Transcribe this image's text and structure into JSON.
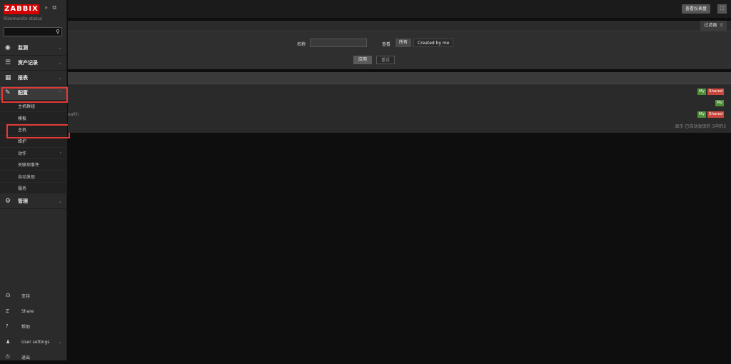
{
  "sidebar": {
    "logo": "ZABBIX",
    "server_name": "Rizemonito status",
    "search_placeholder": "",
    "collapse_icons": [
      "»",
      "⧉"
    ],
    "menu": [
      {
        "id": "monitoring",
        "label": "监测",
        "icon": "◉"
      },
      {
        "id": "inventory",
        "label": "资产记录",
        "icon": "☰"
      },
      {
        "id": "reports",
        "label": "报表",
        "icon": "▦"
      },
      {
        "id": "configuration",
        "label": "配置",
        "icon": "✎"
      }
    ],
    "config_submenu": [
      "主机群组",
      "模板",
      "主机",
      "维护",
      "动作",
      "关联项事件",
      "自动发现",
      "服务"
    ],
    "admin": {
      "label": "管理",
      "icon": "⚙"
    },
    "bottom": [
      {
        "label": "支持",
        "icon": "☊"
      },
      {
        "label": "Share",
        "icon": "Z"
      },
      {
        "label": "帮助",
        "icon": "?"
      },
      {
        "label": "User settings",
        "icon": "♟"
      },
      {
        "label": "退出",
        "icon": "⏻"
      }
    ]
  },
  "topbar": {
    "share_btn": "查看仪表盘",
    "fullscreen_icon": "⛶"
  },
  "filter": {
    "tab_label": "过滤器",
    "tab_icon": "▽",
    "name_label": "名称",
    "view_label": "查看",
    "view_all": "所有",
    "view_me": "Created by me",
    "apply": "应用",
    "reset": "重设"
  },
  "list": {
    "row_fragment": "ealth",
    "badge_my": "My",
    "badge_shared": "Shared",
    "pager": "显示 已自动发现的 3中的3"
  },
  "colors": {
    "accent_red": "#d40000",
    "badge_my": "#4e8f3a",
    "badge_shared": "#c9473b"
  }
}
